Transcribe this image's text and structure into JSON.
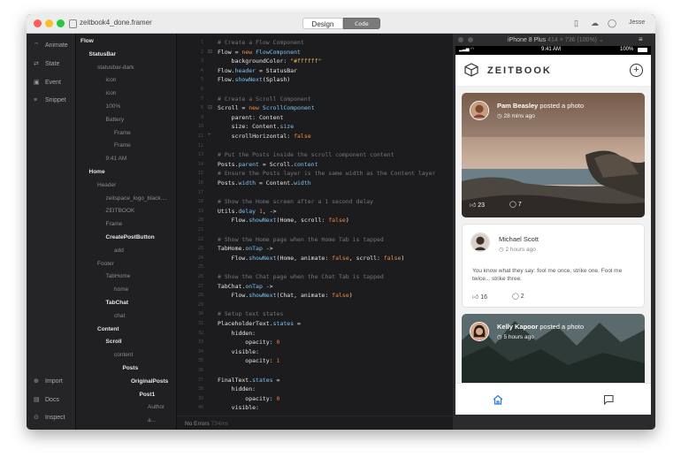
{
  "window": {
    "filename": "zeitbook4_done.framer",
    "mode_tabs": [
      "Design",
      "Code"
    ],
    "active_mode": "Code",
    "user": "Jesse",
    "traffic_light_colors": [
      "#fc5f57",
      "#fdbc2e",
      "#28c840"
    ]
  },
  "sidebar": {
    "top_items": [
      {
        "label": "Animate",
        "icon": "animate-icon"
      },
      {
        "label": "State",
        "icon": "state-icon"
      },
      {
        "label": "Event",
        "icon": "event-icon"
      },
      {
        "label": "Snippet",
        "icon": "snippet-icon"
      }
    ],
    "bottom_items": [
      {
        "label": "Import",
        "icon": "import-icon"
      },
      {
        "label": "Docs",
        "icon": "docs-icon"
      },
      {
        "label": "Inspect",
        "icon": "inspect-icon"
      }
    ]
  },
  "layers": [
    {
      "label": "Flow",
      "bold": true,
      "dot": false
    },
    {
      "label": "StatusBar",
      "bold": true,
      "dot": true
    },
    {
      "label": "statusbar-dark",
      "bold": false,
      "dot": false
    },
    {
      "label": "icon",
      "bold": false,
      "dot": false
    },
    {
      "label": "icon",
      "bold": false,
      "dot": false
    },
    {
      "label": "100%",
      "bold": false,
      "dot": false
    },
    {
      "label": "Battery",
      "bold": false,
      "dot": false
    },
    {
      "label": "Frame",
      "bold": false,
      "dot": false
    },
    {
      "label": "Frame",
      "bold": false,
      "dot": false
    },
    {
      "label": "9:41 AM",
      "bold": false,
      "dot": false
    },
    {
      "label": "Home",
      "bold": true,
      "dot": true
    },
    {
      "label": "Header",
      "bold": false,
      "dot": false
    },
    {
      "label": "zeitspace_logo_black....",
      "bold": false,
      "dot": false
    },
    {
      "label": "ZEITBOOK",
      "bold": false,
      "dot": false
    },
    {
      "label": "Frame",
      "bold": false,
      "dot": false
    },
    {
      "label": "CreatePostButton",
      "bold": true,
      "dot": true
    },
    {
      "label": "add",
      "bold": false,
      "dot": false
    },
    {
      "label": "Footer",
      "bold": false,
      "dot": false
    },
    {
      "label": "TabHome",
      "bold": false,
      "dot": false
    },
    {
      "label": "home",
      "bold": false,
      "dot": false
    },
    {
      "label": "TabChat",
      "bold": true,
      "dot": true
    },
    {
      "label": "chat",
      "bold": false,
      "dot": false
    },
    {
      "label": "Content",
      "bold": true,
      "dot": true
    },
    {
      "label": "Scroll",
      "bold": true,
      "dot": false
    },
    {
      "label": "content",
      "bold": false,
      "dot": false
    },
    {
      "label": "Posts",
      "bold": true,
      "dot": true
    },
    {
      "label": "OriginalPosts",
      "bold": true,
      "dot": true
    },
    {
      "label": "Post1",
      "bold": true,
      "dot": true
    },
    {
      "label": "Author",
      "bold": false,
      "dot": false
    },
    {
      "label": "a...",
      "bold": false,
      "dot": false
    }
  ],
  "code_lines": [
    [
      [
        "c",
        "# Create a Flow Component"
      ]
    ],
    [
      [
        "t",
        "Flow = "
      ],
      [
        "k",
        "new"
      ],
      [
        "t",
        " "
      ],
      [
        "p",
        "FlowComponent"
      ]
    ],
    [
      [
        "t",
        "    backgroundColor: "
      ],
      [
        "s",
        "\"#ffffff\""
      ]
    ],
    [
      [
        "t",
        "Flow."
      ],
      [
        "p",
        "header"
      ],
      [
        "t",
        " = StatusBar"
      ]
    ],
    [
      [
        "t",
        "Flow."
      ],
      [
        "p",
        "showNext"
      ],
      [
        "t",
        "(Splash)"
      ]
    ],
    [
      [
        "t",
        ""
      ]
    ],
    [
      [
        "c",
        "# Create a Scroll Component"
      ]
    ],
    [
      [
        "t",
        "Scroll = "
      ],
      [
        "k",
        "new"
      ],
      [
        "t",
        " "
      ],
      [
        "p",
        "ScrollComponent"
      ]
    ],
    [
      [
        "t",
        "    parent: Content"
      ]
    ],
    [
      [
        "t",
        "    size: Content."
      ],
      [
        "p",
        "size"
      ]
    ],
    [
      [
        "t",
        "    scrollHorizontal: "
      ],
      [
        "k",
        "false"
      ]
    ],
    [
      [
        "t",
        ""
      ]
    ],
    [
      [
        "c",
        "# Put the Posts inside the scroll component content"
      ]
    ],
    [
      [
        "t",
        "Posts."
      ],
      [
        "p",
        "parent"
      ],
      [
        "t",
        " = Scroll."
      ],
      [
        "p",
        "content"
      ]
    ],
    [
      [
        "c",
        "# Ensure the Posts layer is the same width as the Content layer"
      ]
    ],
    [
      [
        "t",
        "Posts."
      ],
      [
        "p",
        "width"
      ],
      [
        "t",
        " = Content."
      ],
      [
        "p",
        "width"
      ]
    ],
    [
      [
        "t",
        ""
      ]
    ],
    [
      [
        "c",
        "# Show the Home screen after a 1 second delay"
      ]
    ],
    [
      [
        "t",
        "Utils."
      ],
      [
        "p",
        "delay"
      ],
      [
        "t",
        " "
      ],
      [
        "n",
        "1"
      ],
      [
        "t",
        ", ->"
      ]
    ],
    [
      [
        "t",
        "    Flow."
      ],
      [
        "p",
        "showNext"
      ],
      [
        "t",
        "(Home, scroll: "
      ],
      [
        "k",
        "false"
      ],
      [
        "t",
        ")"
      ]
    ],
    [
      [
        "t",
        ""
      ]
    ],
    [
      [
        "c",
        "# Show the Home page when the Home Tab is tapped"
      ]
    ],
    [
      [
        "t",
        "TabHome."
      ],
      [
        "p",
        "onTap"
      ],
      [
        "t",
        " ->"
      ]
    ],
    [
      [
        "t",
        "    Flow."
      ],
      [
        "p",
        "showNext"
      ],
      [
        "t",
        "(Home, animate: "
      ],
      [
        "k",
        "false"
      ],
      [
        "t",
        ", scroll: "
      ],
      [
        "k",
        "false"
      ],
      [
        "t",
        ")"
      ]
    ],
    [
      [
        "t",
        ""
      ]
    ],
    [
      [
        "c",
        "# Show the Chat page when the Chat Tab is tapped"
      ]
    ],
    [
      [
        "t",
        "TabChat."
      ],
      [
        "p",
        "onTap"
      ],
      [
        "t",
        " ->"
      ]
    ],
    [
      [
        "t",
        "    Flow."
      ],
      [
        "p",
        "showNext"
      ],
      [
        "t",
        "(Chat, animate: "
      ],
      [
        "k",
        "false"
      ],
      [
        "t",
        ")"
      ]
    ],
    [
      [
        "t",
        ""
      ]
    ],
    [
      [
        "c",
        "# Setup text states"
      ]
    ],
    [
      [
        "t",
        "PlaceholderText."
      ],
      [
        "p",
        "states"
      ],
      [
        "t",
        " ="
      ]
    ],
    [
      [
        "t",
        "    hidden:"
      ]
    ],
    [
      [
        "t",
        "        opacity: "
      ],
      [
        "n",
        "0"
      ]
    ],
    [
      [
        "t",
        "    visible:"
      ]
    ],
    [
      [
        "t",
        "        opacity: "
      ],
      [
        "n",
        "1"
      ]
    ],
    [
      [
        "t",
        ""
      ]
    ],
    [
      [
        "t",
        "FinalText."
      ],
      [
        "p",
        "states"
      ],
      [
        "t",
        " ="
      ]
    ],
    [
      [
        "t",
        "    hidden:"
      ]
    ],
    [
      [
        "t",
        "        opacity: "
      ],
      [
        "n",
        "0"
      ]
    ],
    [
      [
        "t",
        "    visible:"
      ]
    ]
  ],
  "editor_status": {
    "errors": "No Errors",
    "time": "734ms"
  },
  "preview": {
    "device": "iPhone 8 Plus",
    "size": "414 × 736 (100%)",
    "status_time": "9:41 AM",
    "battery": "100%"
  },
  "app": {
    "title": "ZEITBOOK",
    "posts": [
      {
        "author": "Pam Beasley",
        "action": "posted a photo",
        "time": "28 mins ago",
        "likes": "23",
        "comments": "7"
      },
      {
        "author": "Michael Scott",
        "time": "2 hours ago",
        "text": "You know what they say: fool me once, strike one. Fool me twice... strike three.",
        "likes": "16",
        "comments": "2"
      },
      {
        "author": "Kelly Kapoor",
        "action": "posted a photo",
        "time": "5 hours ago"
      }
    ]
  }
}
